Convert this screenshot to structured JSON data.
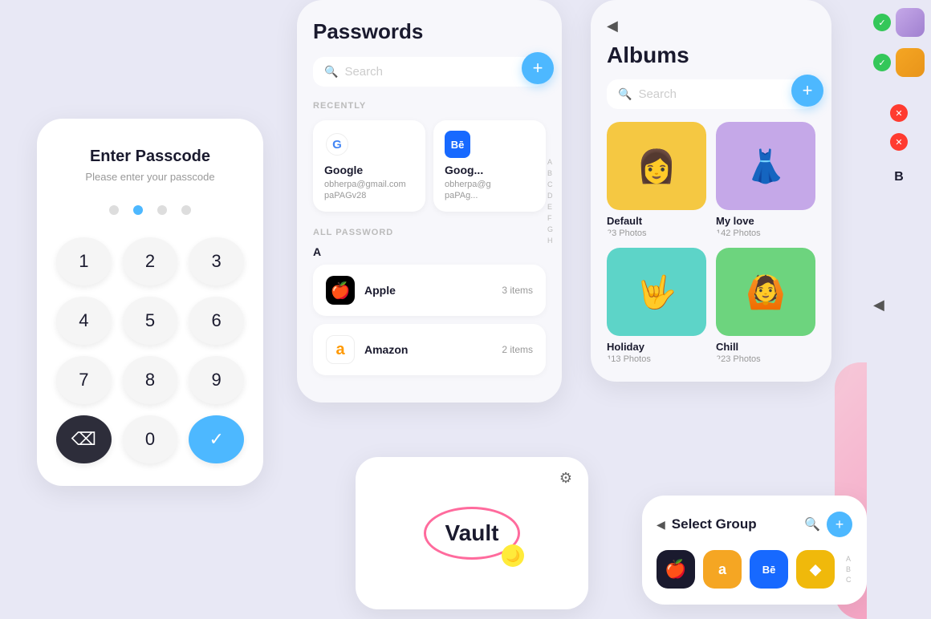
{
  "background": "#e8e8f5",
  "passcode": {
    "title": "Enter Passcode",
    "subtitle": "Please enter your passcode",
    "dots": [
      false,
      true,
      false,
      false
    ],
    "keys": [
      "1",
      "2",
      "3",
      "4",
      "5",
      "6",
      "7",
      "8",
      "9",
      "",
      "0",
      "⌫"
    ]
  },
  "passwords": {
    "title": "Passwords",
    "search_placeholder": "Search",
    "add_label": "+",
    "recently_label": "RECENTLY",
    "all_password_label": "ALL PASSWORD",
    "recent_items": [
      {
        "name": "Google",
        "email": "obherpa@gmail.com",
        "pass": "paPAGv28"
      },
      {
        "name": "Goog...",
        "email": "obherpa@g",
        "pass": "paPAg..."
      }
    ],
    "alpha_a": "A",
    "items": [
      {
        "name": "Apple",
        "count": "3 items"
      },
      {
        "name": "Amazon",
        "count": "2 items"
      }
    ],
    "alphabet": [
      "A",
      "B",
      "C",
      "D",
      "E",
      "F",
      "G",
      "H"
    ]
  },
  "albums": {
    "title": "Albums",
    "search_placeholder": "Search",
    "add_label": "+",
    "back_label": "◀",
    "items": [
      {
        "name": "Default",
        "count": "23 Photos",
        "color": "yellow",
        "emoji": "👩"
      },
      {
        "name": "My love",
        "count": "142 Photos",
        "color": "purple",
        "emoji": "👗"
      },
      {
        "name": "Holiday",
        "count": "113 Photos",
        "color": "teal",
        "emoji": "🤟"
      },
      {
        "name": "Chill",
        "count": "223 Photos",
        "color": "green",
        "emoji": "🙆"
      }
    ]
  },
  "vault": {
    "text": "Vault",
    "settings_icon": "⚙"
  },
  "select_group": {
    "title": "Select Group",
    "back_label": "◀",
    "search_label": "🔍",
    "add_label": "+",
    "alphabet": [
      "A",
      "B",
      "C"
    ],
    "groups": [
      {
        "icon": "🍎",
        "style": "black"
      },
      {
        "icon": "a",
        "style": "amazon"
      },
      {
        "icon": "Bē",
        "style": "blue-brand"
      },
      {
        "icon": "◆",
        "style": "yellow-brand"
      }
    ]
  },
  "right_panel": {
    "items": [
      {
        "check": "green",
        "has_avatar": true,
        "avatar_color": "#c5a8e8"
      },
      {
        "check": "green",
        "has_avatar": true,
        "avatar_color": "#f5a623"
      },
      {
        "check": "red",
        "has_avatar": false
      },
      {
        "check": "red",
        "has_avatar": false
      },
      {
        "label": "B",
        "has_avatar": false
      }
    ]
  }
}
